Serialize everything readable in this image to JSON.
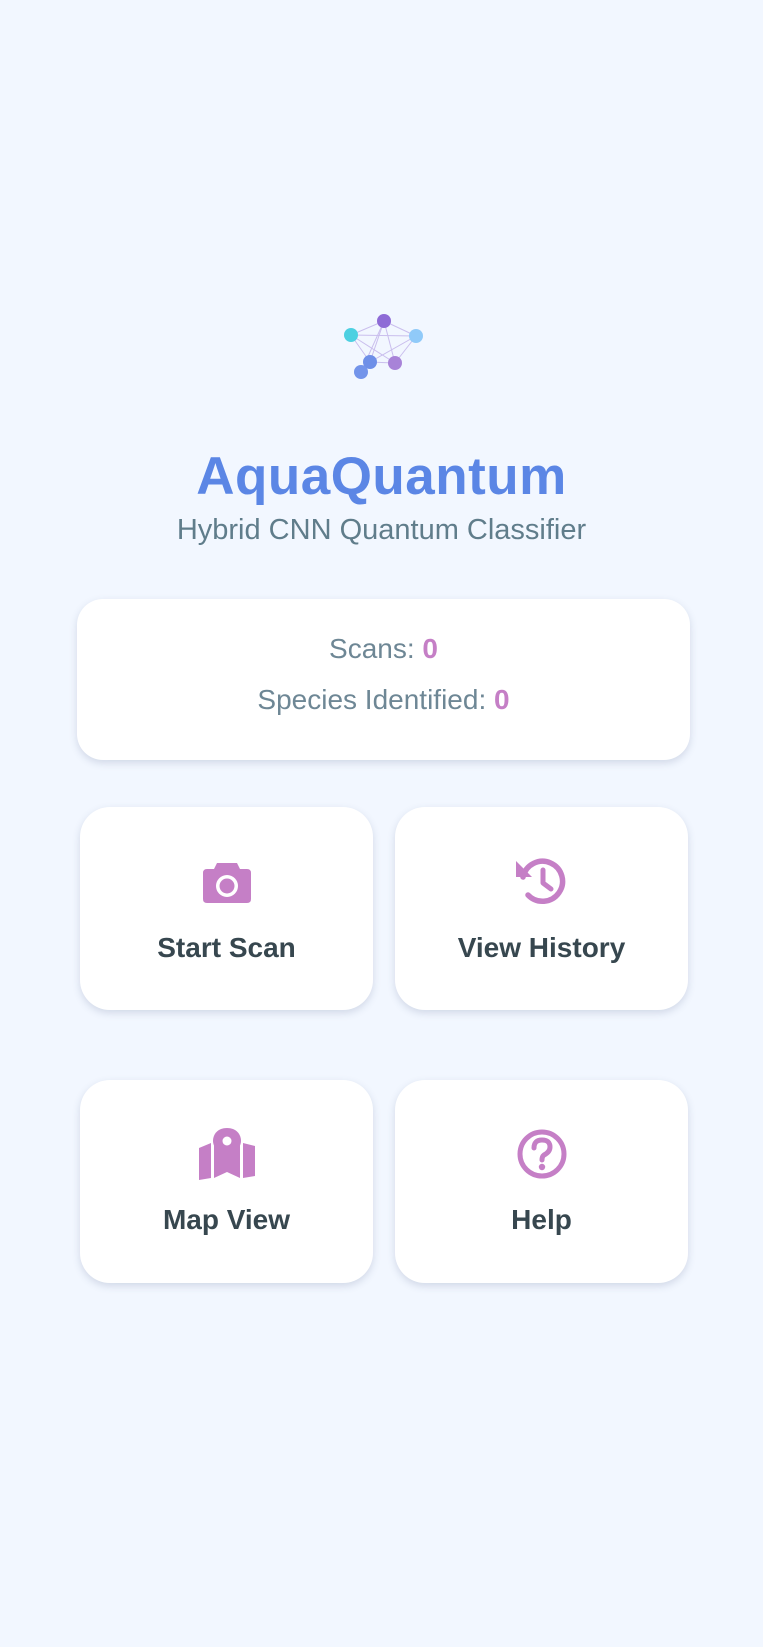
{
  "app": {
    "title": "AquaQuantum",
    "subtitle": "Hybrid CNN Quantum Classifier",
    "logo_icon": "network-nodes-icon"
  },
  "stats": {
    "scans_label": "Scans:",
    "scans_value": "0",
    "species_label": "Species Identified:",
    "species_value": "0"
  },
  "actions": [
    {
      "label": "Start Scan",
      "icon": "camera-icon"
    },
    {
      "label": "View History",
      "icon": "history-icon"
    },
    {
      "label": "Map View",
      "icon": "map-marker-icon"
    },
    {
      "label": "Help",
      "icon": "help-circle-icon"
    }
  ],
  "colors": {
    "background": "#f2f7ff",
    "title": "#5b86e5",
    "subtitle": "#607d8b",
    "accent": "#c57fc6",
    "tile_text": "#37474f"
  }
}
